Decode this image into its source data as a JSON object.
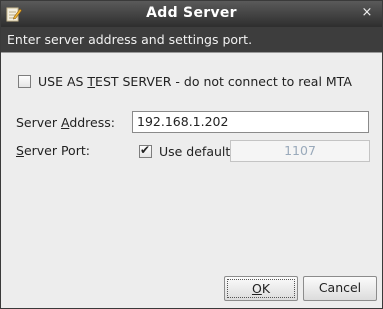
{
  "window": {
    "title": "Add Server",
    "close_glyph": "×",
    "title_icon": "notepad-edit-icon"
  },
  "header": {
    "text": "Enter server address and settings port."
  },
  "test_server": {
    "checked": false,
    "label_pre": "USE AS ",
    "label_mn": "T",
    "label_post": "EST SERVER - do not connect to real MTA"
  },
  "server_address": {
    "label_pre": "Server ",
    "label_mn": "A",
    "label_post": "ddress:",
    "value": "192.168.1.202"
  },
  "server_port": {
    "label_pre": "",
    "label_mn": "S",
    "label_post": "erver Port:",
    "use_default_checked": true,
    "use_default_label": "Use default",
    "port_value": "1107"
  },
  "buttons": {
    "ok_mn": "O",
    "ok_rest": "K",
    "cancel": "Cancel"
  }
}
